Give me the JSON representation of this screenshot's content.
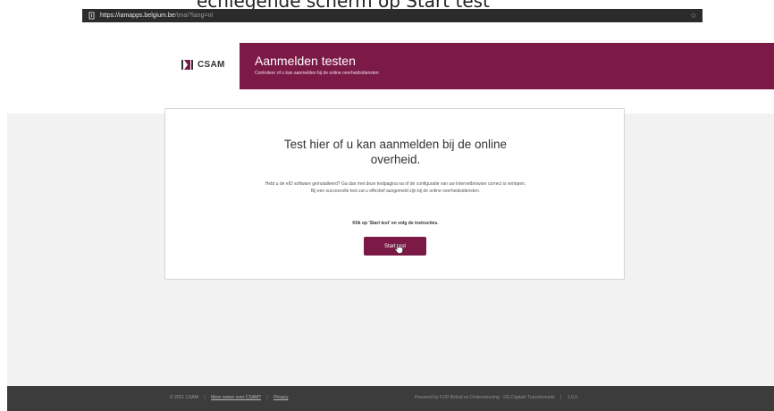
{
  "browser": {
    "url_host": "https://iamapps.belgium.be",
    "url_path": "/tma/?lang=nl"
  },
  "doc_fragment": "ecniegende scherm op Start test",
  "header": {
    "logo_text": "CSAM",
    "title": "Aanmelden testen",
    "subtitle": "Controleer of u kan aanmelden bij de online overheidsdiensten"
  },
  "card": {
    "heading": "Test hier of u kan aanmelden bij de online overheid.",
    "intro": "Hebt u de eID software geïnstalleerd? Ga dan met deze testpagina na of de configuratie van uw internetbrowser correct is verlopen. Bij een succesvolle test zal u effectief aangemeld zijn bij de online overheidsdiensten.",
    "instruction": "Klik op 'Start test' en volg de instructies.",
    "start_button": "Start test"
  },
  "footer": {
    "copyright": "© 2021 CSAM",
    "more_link": "Meer weten over CSAM?",
    "privacy_link": "Privacy",
    "powered_by": "Powered by FOD Beleid en Ondersteuning · DG Digitale Transformatie",
    "version": "1.0.0"
  },
  "colors": {
    "brand": "#7b1a47",
    "footer_bg": "#3c3c3c",
    "page_bg": "#f2f2f2"
  }
}
